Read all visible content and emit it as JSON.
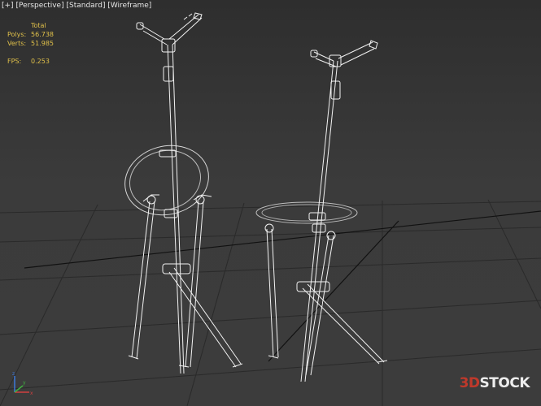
{
  "viewport": {
    "labels": [
      "[+]",
      "[Perspective]",
      "[Standard]",
      "[Wireframe]"
    ]
  },
  "stats": {
    "header": "Total",
    "polys_label": "Polys:",
    "polys_value": "56.738",
    "verts_label": "Verts:",
    "verts_value": "51.985",
    "fps_label": "FPS:",
    "fps_value": "0.253"
  },
  "gizmo": {
    "x_label": "x",
    "y_label": "y",
    "z_label": "z"
  },
  "watermark": {
    "part1": "3D",
    "part2": "STOCK"
  },
  "colors": {
    "background": "#3a3a3a",
    "grid": "#2a2a2a",
    "wire": "#f2f2f2",
    "stats_text": "#e0c04a",
    "logo_red": "#c0392b"
  }
}
